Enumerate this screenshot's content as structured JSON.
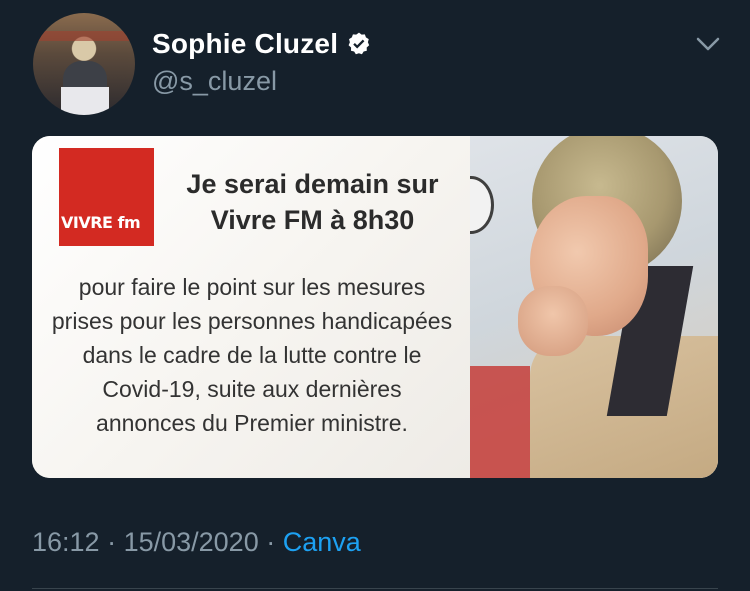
{
  "author": {
    "name": "Sophie Cluzel",
    "handle": "@s_cluzel",
    "verified": true
  },
  "menu_icon": "chevron-down-icon",
  "card": {
    "logo_text": "VIVRE fm",
    "headline": "Je serai demain sur Vivre FM à 8h30",
    "body": "pour faire le point sur les mesures prises pour les personnes handicapées dans le cadre de la lutte contre le Covid-19, suite aux dernières annonces du Premier ministre."
  },
  "meta": {
    "time": "16:12",
    "separator": " · ",
    "date": "15/03/2020",
    "separator2": " · ",
    "source": "Canva"
  },
  "colors": {
    "background": "#15202b",
    "secondary_text": "#8899a6",
    "link": "#1da1f2",
    "logo_red": "#d32a22"
  }
}
